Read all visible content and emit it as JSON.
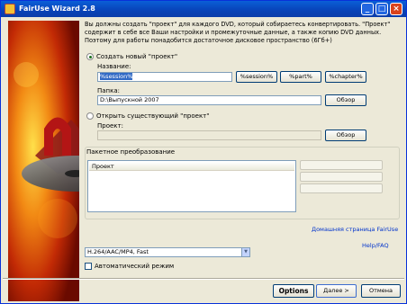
{
  "window": {
    "title": "FairUse Wizard 2.8",
    "controls": {
      "minimize": "_",
      "maximize": "□",
      "close": "×"
    }
  },
  "description": "Вы должны создать \"проект\" для каждого DVD, который собираетесь конвертировать. \"Проект\" содержит в себе все Ваши настройки и промежуточные данные, а также копию DVD данных. Поэтому для работы понадобится достаточное дисковое пространство (6Гб+)",
  "create_project": {
    "radio_label": "Создать новый \"проект\"",
    "selected": true,
    "name_label": "Название:",
    "name_value": "%session%",
    "session_button": "%session%",
    "part_button": "%part%",
    "chapter_button": "%chapter%",
    "folder_label": "Папка:",
    "folder_value": "D:\\Выпускной 2007",
    "browse_button": "Обзор"
  },
  "open_project": {
    "radio_label": "Открыть существующий \"проект\"",
    "selected": false,
    "project_label": "Проект:",
    "project_value": "",
    "browse_button": "Обзор"
  },
  "batch": {
    "group_label": "Пакетное преобразование",
    "list_header": "Проект"
  },
  "links": {
    "homepage": "Домашняя страница FairUse",
    "help": "Help/FAQ"
  },
  "profile": {
    "selected": "H.264/AAC/MP4, Fast"
  },
  "auto_mode": {
    "label": "Автоматический режим",
    "checked": false
  },
  "footer": {
    "options": "Options",
    "next": "Далее >",
    "cancel": "Отмена"
  }
}
